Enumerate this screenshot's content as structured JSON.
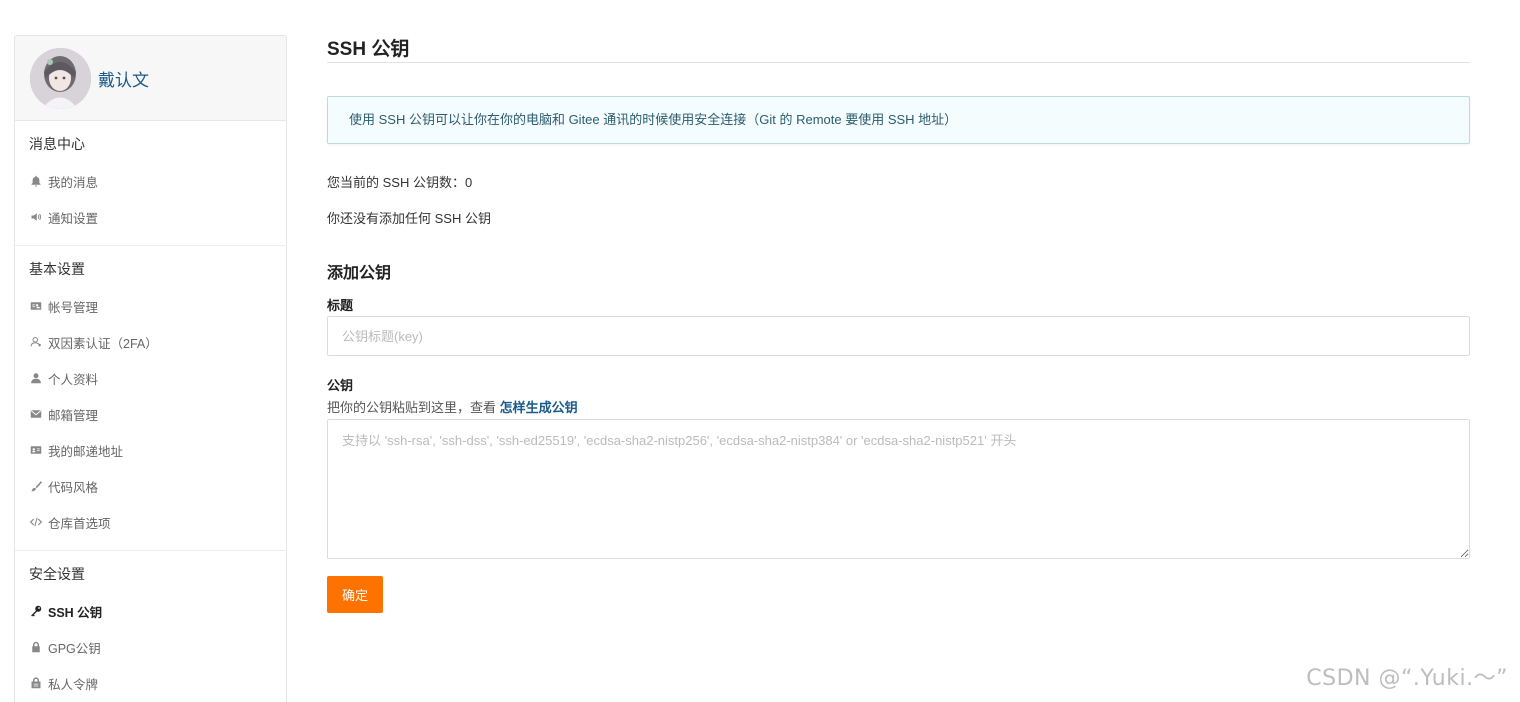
{
  "profile": {
    "username": "戴认文"
  },
  "sidebar": {
    "sections": [
      {
        "title": "消息中心",
        "items": [
          {
            "label": "我的消息",
            "icon": "bell-icon"
          },
          {
            "label": "通知设置",
            "icon": "speaker-icon"
          }
        ]
      },
      {
        "title": "基本设置",
        "items": [
          {
            "label": "帐号管理",
            "icon": "id-card-icon"
          },
          {
            "label": "双因素认证（2FA）",
            "icon": "user-outline-icon"
          },
          {
            "label": "个人资料",
            "icon": "user-icon"
          },
          {
            "label": "邮箱管理",
            "icon": "envelope-icon"
          },
          {
            "label": "我的邮递地址",
            "icon": "address-card-icon"
          },
          {
            "label": "代码风格",
            "icon": "brush-icon"
          },
          {
            "label": "仓库首选项",
            "icon": "code-icon"
          }
        ]
      },
      {
        "title": "安全设置",
        "items": [
          {
            "label": "SSH 公钥",
            "icon": "key-icon",
            "active": true
          },
          {
            "label": "GPG公钥",
            "icon": "lock-icon"
          },
          {
            "label": "私人令牌",
            "icon": "token-icon"
          }
        ]
      }
    ]
  },
  "main": {
    "title": "SSH 公钥",
    "info": "使用 SSH 公钥可以让你在你的电脑和 Gitee 通讯的时候使用安全连接（Git 的 Remote 要使用 SSH 地址）",
    "count_label": "您当前的 SSH 公钥数：",
    "count_value": "0",
    "empty_text": "你还没有添加任何 SSH 公钥",
    "add_title": "添加公钥",
    "form": {
      "title_label": "标题",
      "title_placeholder": "公钥标题(key)",
      "title_value": "",
      "key_label": "公钥",
      "key_hint": "把你的公钥粘贴到这里，查看",
      "key_hint_link": "怎样生成公钥",
      "key_placeholder": "支持以 'ssh-rsa', 'ssh-dss', 'ssh-ed25519', 'ecdsa-sha2-nistp256', 'ecdsa-sha2-nistp384' or 'ecdsa-sha2-nistp521' 开头",
      "key_value": "",
      "submit_label": "确定"
    }
  },
  "watermark": "CSDN @“.Yuki.～”",
  "colors": {
    "accent": "#fe7300",
    "link": "#1a5a8a",
    "info_bg": "#f4fcfd",
    "info_border": "#b9dbe3"
  }
}
